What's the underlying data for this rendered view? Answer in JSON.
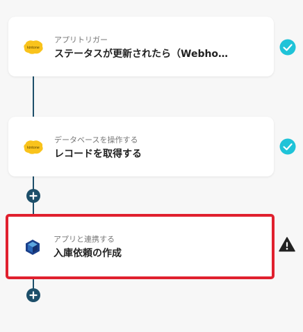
{
  "flow": {
    "steps": [
      {
        "kicker": "アプリトリガー",
        "title": "ステータスが更新されたら（Webho…",
        "app_icon": "kintone-icon",
        "status": "complete-check-icon"
      },
      {
        "kicker": "データベースを操作する",
        "title": "レコードを取得する",
        "app_icon": "kintone-icon",
        "status": "complete-check-icon"
      },
      {
        "kicker": "アプリと連携する",
        "title": "入庫依頼の作成",
        "app_icon": "cube-app-icon",
        "status": "warning-icon"
      }
    ],
    "kintone_logo_text": "kintone"
  },
  "colors": {
    "connector": "#1d4f6a",
    "check": "#1fc3d8",
    "warning": "#222222",
    "selection": "#e0202e",
    "kintone": "#f9c31c"
  }
}
